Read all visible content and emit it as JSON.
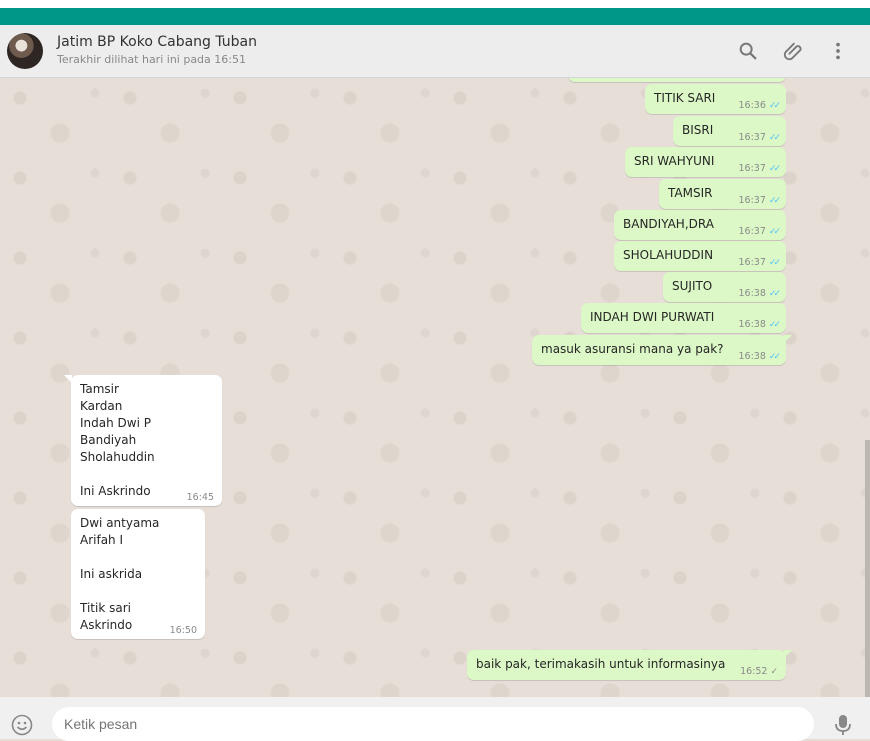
{
  "header": {
    "contact_name": "Jatim BP Koko Cabang Tuban",
    "last_seen": "Terakhir dilihat hari ini pada 16:51",
    "icons": [
      "search-icon",
      "attach-icon",
      "menu-icon"
    ]
  },
  "messages": [
    {
      "dir": "out",
      "text": "TITIK SARI",
      "time": "16:36",
      "status": "read"
    },
    {
      "dir": "out",
      "text": "BISRI",
      "time": "16:37",
      "status": "read"
    },
    {
      "dir": "out",
      "text": "SRI WAHYUNI",
      "time": "16:37",
      "status": "read"
    },
    {
      "dir": "out",
      "text": "TAMSIR",
      "time": "16:37",
      "status": "read"
    },
    {
      "dir": "out",
      "text": "BANDIYAH,DRA",
      "time": "16:37",
      "status": "read"
    },
    {
      "dir": "out",
      "text": "SHOLAHUDDIN",
      "time": "16:37",
      "status": "read"
    },
    {
      "dir": "out",
      "text": "SUJITO",
      "time": "16:38",
      "status": "read"
    },
    {
      "dir": "out",
      "text": "INDAH DWI PURWATI",
      "time": "16:38",
      "status": "read"
    },
    {
      "dir": "out",
      "text": "masuk asuransi mana ya pak?",
      "time": "16:38",
      "status": "read"
    },
    {
      "dir": "in",
      "text": "Tamsir\nKardan\nIndah Dwi P\nBandiyah\nSholahuddin\n\nIni Askrindo",
      "time": "16:45"
    },
    {
      "dir": "in",
      "text": "Dwi antyama\nArifah I\n\nIni askrida\n\nTitik sari\nAskrindo",
      "time": "16:50"
    },
    {
      "dir": "out",
      "text": "baik pak, terimakasih untuk informasinya",
      "time": "16:52",
      "status": "sent"
    }
  ],
  "composer": {
    "placeholder": "Ketik pesan"
  },
  "colors": {
    "accent": "#009688",
    "outgoing_bubble": "#dcf8c6",
    "incoming_bubble": "#ffffff",
    "read_ticks": "#4fc3f7"
  }
}
